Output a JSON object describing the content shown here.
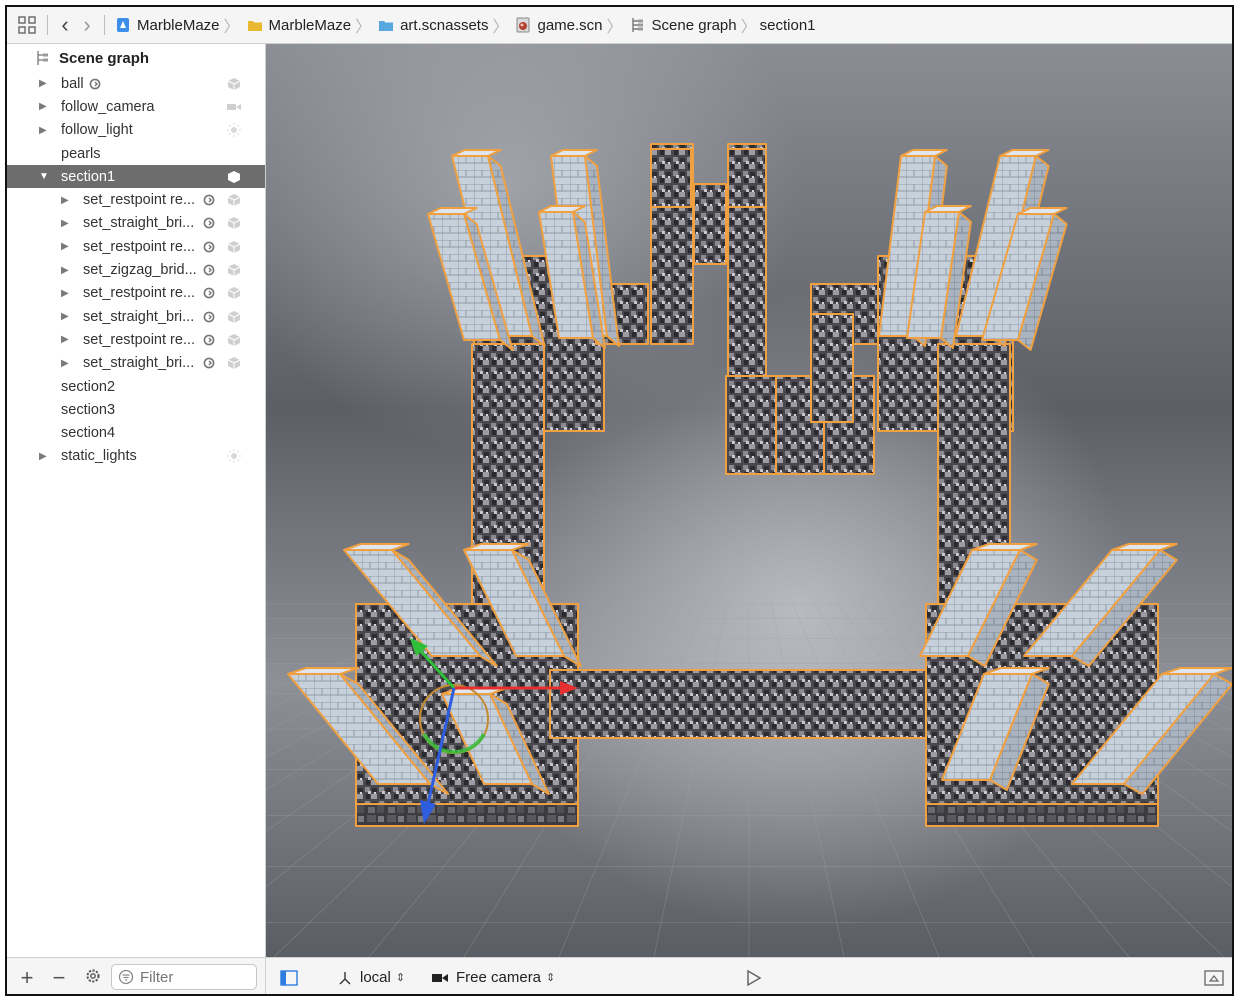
{
  "breadcrumb": [
    {
      "label": "MarbleMaze",
      "icon": "project-icon"
    },
    {
      "label": "MarbleMaze",
      "icon": "folder-icon"
    },
    {
      "label": "art.scnassets",
      "icon": "folder-icon"
    },
    {
      "label": "game.scn",
      "icon": "scene-file-icon"
    },
    {
      "label": "Scene graph",
      "icon": "scene-graph-icon"
    },
    {
      "label": "section1",
      "icon": ""
    }
  ],
  "sidebar": {
    "title": "Scene graph",
    "nodes": [
      {
        "label": "ball",
        "expandable": true,
        "expanded": false,
        "indent": 0,
        "icon": "geometry-icon",
        "linked": true,
        "selected": false
      },
      {
        "label": "follow_camera",
        "expandable": true,
        "expanded": false,
        "indent": 0,
        "icon": "camera-icon",
        "linked": false,
        "selected": false
      },
      {
        "label": "follow_light",
        "expandable": true,
        "expanded": false,
        "indent": 0,
        "icon": "light-icon",
        "linked": false,
        "selected": false
      },
      {
        "label": "pearls",
        "expandable": false,
        "expanded": false,
        "indent": 0,
        "icon": "",
        "linked": false,
        "selected": false
      },
      {
        "label": "section1",
        "expandable": true,
        "expanded": true,
        "indent": 0,
        "icon": "geometry-icon",
        "linked": false,
        "selected": true
      },
      {
        "label": "set_restpoint re...",
        "expandable": true,
        "expanded": false,
        "indent": 1,
        "icon": "geometry-icon",
        "linked": true,
        "selected": false
      },
      {
        "label": "set_straight_bri...",
        "expandable": true,
        "expanded": false,
        "indent": 1,
        "icon": "geometry-icon",
        "linked": true,
        "selected": false
      },
      {
        "label": "set_restpoint re...",
        "expandable": true,
        "expanded": false,
        "indent": 1,
        "icon": "geometry-icon",
        "linked": true,
        "selected": false
      },
      {
        "label": "set_zigzag_brid...",
        "expandable": true,
        "expanded": false,
        "indent": 1,
        "icon": "geometry-icon",
        "linked": true,
        "selected": false
      },
      {
        "label": "set_restpoint re...",
        "expandable": true,
        "expanded": false,
        "indent": 1,
        "icon": "geometry-icon",
        "linked": true,
        "selected": false
      },
      {
        "label": "set_straight_bri...",
        "expandable": true,
        "expanded": false,
        "indent": 1,
        "icon": "geometry-icon",
        "linked": true,
        "selected": false
      },
      {
        "label": "set_restpoint re...",
        "expandable": true,
        "expanded": false,
        "indent": 1,
        "icon": "geometry-icon",
        "linked": true,
        "selected": false
      },
      {
        "label": "set_straight_bri...",
        "expandable": true,
        "expanded": false,
        "indent": 1,
        "icon": "geometry-icon",
        "linked": true,
        "selected": false
      },
      {
        "label": "section2",
        "expandable": false,
        "expanded": false,
        "indent": 0,
        "icon": "",
        "linked": false,
        "selected": false
      },
      {
        "label": "section3",
        "expandable": false,
        "expanded": false,
        "indent": 0,
        "icon": "",
        "linked": false,
        "selected": false
      },
      {
        "label": "section4",
        "expandable": false,
        "expanded": false,
        "indent": 0,
        "icon": "",
        "linked": false,
        "selected": false
      },
      {
        "label": "static_lights",
        "expandable": true,
        "expanded": false,
        "indent": 0,
        "icon": "light-icon",
        "linked": false,
        "selected": false
      }
    ],
    "filter_placeholder": "Filter"
  },
  "toolbar": {
    "coordinate_space": "local",
    "camera": "Free camera"
  },
  "colors": {
    "selection_outline": "#f0a040",
    "selected_row": "#6d6d6d",
    "axis_x": "#e53030",
    "axis_y": "#2fbf3a",
    "axis_z": "#2f5de0"
  }
}
